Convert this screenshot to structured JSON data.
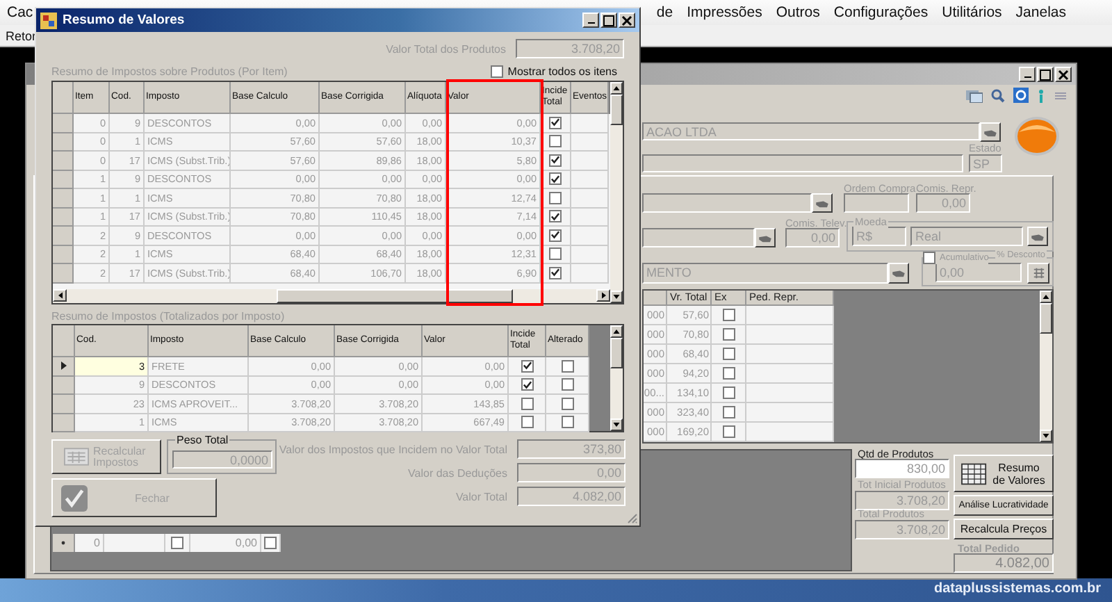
{
  "menu": [
    {
      "label": "Cac"
    },
    {
      "label": "de"
    },
    {
      "label": "Impressões"
    },
    {
      "label": "Outros"
    },
    {
      "label": "Configurações"
    },
    {
      "label": "Utilitários"
    },
    {
      "label": "Janelas"
    }
  ],
  "toolbar": [
    {
      "label": "Retor"
    }
  ],
  "order_window": {
    "customer": "ACAO LTDA",
    "estado": {
      "label": "Estado",
      "value": "SP"
    },
    "ordem_compra": {
      "label": "Ordem Compra"
    },
    "comis_repr": {
      "label": "Comis. Repr.",
      "value": "0,00"
    },
    "comis_telev": {
      "label": "Comis. Telev.",
      "value": "0,00"
    },
    "moeda": {
      "label": "Moeda",
      "code": "R$",
      "name": "Real"
    },
    "acumulativo": {
      "label": "Acumulativo",
      "checked": false
    },
    "desconto": {
      "label": "% Desconto",
      "value": "0,00"
    },
    "field_3": "MENTO",
    "items_table": {
      "columns": [
        "Vr. Total",
        "Ex",
        "Ped. Repr."
      ],
      "rows": [
        {
          "column_1": "000",
          "vr_total": "57,60",
          "ex": false
        },
        {
          "column_1": "000",
          "vr_total": "70,80",
          "ex": false
        },
        {
          "column_1": "000",
          "vr_total": "68,40",
          "ex": false
        },
        {
          "column_1": "000",
          "vr_total": "94,20",
          "ex": false
        },
        {
          "column_1": "00...",
          "vr_total": "134,10",
          "ex": false
        },
        {
          "column_1": "000",
          "vr_total": "323,40",
          "ex": false
        },
        {
          "column_1": "000",
          "vr_total": "169,20",
          "ex": false
        }
      ]
    },
    "lower_row": {
      "column_1": "0",
      "check_1": false,
      "value": "0,00",
      "check_2": false
    },
    "qtd_produtos": {
      "label": "Qtd de Produtos",
      "value": "830,00"
    },
    "tot_inicial": {
      "label": "Tot Inicial Produtos",
      "value": "3.708,20"
    },
    "total_produtos": {
      "label": "Total Produtos",
      "value": "3.708,20"
    },
    "total_pedido": {
      "label": "Total Pedido",
      "value": "4.082,00"
    },
    "buttons": [
      "Resumo de Valores",
      "Análise Lucratividade",
      "Recalcula Preços"
    ]
  },
  "dialog": {
    "title": "Resumo de Valores",
    "valor_total_produtos": {
      "label": "Valor Total dos Produtos",
      "value": "3.708,20"
    },
    "items_section": "Resumo de Impostos sobre Produtos (Por Item)",
    "mostrar_todos": {
      "label": "Mostrar todos os itens",
      "checked": false
    },
    "items_grid": {
      "columns": [
        {
          "label": "Item",
          "highlighted": false
        },
        {
          "label": "Cod.",
          "highlighted": false
        },
        {
          "label": "Imposto",
          "highlighted": false
        },
        {
          "label": "Base Calculo",
          "highlighted": false
        },
        {
          "label": "Base Corrigida",
          "highlighted": false
        },
        {
          "label": "Alíquota",
          "highlighted": false
        },
        {
          "label": "Valor",
          "highlighted": true
        },
        {
          "label": "Incide Total",
          "highlighted": false
        },
        {
          "label": "Eventos",
          "highlighted": false
        }
      ],
      "rows": [
        {
          "item": "0",
          "cod": "9",
          "imposto": "DESCONTOS",
          "base_calculo": "0,00",
          "base_corrigida": "0,00",
          "aliquota": "0,00",
          "valor": "0,00",
          "incide_total": true
        },
        {
          "item": "0",
          "cod": "1",
          "imposto": "ICMS",
          "base_calculo": "57,60",
          "base_corrigida": "57,60",
          "aliquota": "18,00",
          "valor": "10,37",
          "incide_total": false
        },
        {
          "item": "0",
          "cod": "17",
          "imposto": "ICMS (Subst.Trib.)",
          "base_calculo": "57,60",
          "base_corrigida": "89,86",
          "aliquota": "18,00",
          "valor": "5,80",
          "incide_total": true
        },
        {
          "item": "1",
          "cod": "9",
          "imposto": "DESCONTOS",
          "base_calculo": "0,00",
          "base_corrigida": "0,00",
          "aliquota": "0,00",
          "valor": "0,00",
          "incide_total": true
        },
        {
          "item": "1",
          "cod": "1",
          "imposto": "ICMS",
          "base_calculo": "70,80",
          "base_corrigida": "70,80",
          "aliquota": "18,00",
          "valor": "12,74",
          "incide_total": false
        },
        {
          "item": "1",
          "cod": "17",
          "imposto": "ICMS (Subst.Trib.)",
          "base_calculo": "70,80",
          "base_corrigida": "110,45",
          "aliquota": "18,00",
          "valor": "7,14",
          "incide_total": true
        },
        {
          "item": "2",
          "cod": "9",
          "imposto": "DESCONTOS",
          "base_calculo": "0,00",
          "base_corrigida": "0,00",
          "aliquota": "0,00",
          "valor": "0,00",
          "incide_total": true
        },
        {
          "item": "2",
          "cod": "1",
          "imposto": "ICMS",
          "base_calculo": "68,40",
          "base_corrigida": "68,40",
          "aliquota": "18,00",
          "valor": "12,31",
          "incide_total": false
        },
        {
          "item": "2",
          "cod": "17",
          "imposto": "ICMS (Subst.Trib.)",
          "base_calculo": "68,40",
          "base_corrigida": "106,70",
          "aliquota": "18,00",
          "valor": "6,90",
          "incide_total": true
        }
      ]
    },
    "totals_section": "Resumo de Impostos (Totalizados por Imposto)",
    "totals_grid": {
      "columns": [
        "Cod.",
        "Imposto",
        "Base Calculo",
        "Base Corrigida",
        "Valor",
        "Incide Total",
        "Alterado"
      ],
      "rows": [
        {
          "cod": "3",
          "imposto": "FRETE",
          "base_calculo": "0,00",
          "base_corrigida": "0,00",
          "valor": "0,00",
          "incide_total": true,
          "alterado": false,
          "selected": true
        },
        {
          "cod": "9",
          "imposto": "DESCONTOS",
          "base_calculo": "0,00",
          "base_corrigida": "0,00",
          "valor": "0,00",
          "incide_total": true,
          "alterado": false,
          "selected": false
        },
        {
          "cod": "23",
          "imposto": "ICMS APROVEIT...",
          "base_calculo": "3.708,20",
          "base_corrigida": "3.708,20",
          "valor": "143,85",
          "incide_total": false,
          "alterado": false,
          "selected": false
        },
        {
          "cod": "1",
          "imposto": "ICMS",
          "base_calculo": "3.708,20",
          "base_corrigida": "3.708,20",
          "valor": "667,49",
          "incide_total": false,
          "alterado": false,
          "selected": false
        }
      ]
    },
    "recalcular_button": {
      "label": "Recalcular Impostos",
      "disabled": true
    },
    "peso_total": {
      "label": "Peso Total",
      "value": "0,0000"
    },
    "summary": [
      {
        "label": "Valor dos Impostos que Incidem no Valor Total",
        "value": "373,80"
      },
      {
        "label": "Valor das Deduções",
        "value": "0,00"
      },
      {
        "label": "Valor Total",
        "value": "4.082,00"
      }
    ],
    "fechar_button": {
      "label": "Fechar",
      "disabled": true
    }
  },
  "brand_text": "dataplussistemas.com.br"
}
